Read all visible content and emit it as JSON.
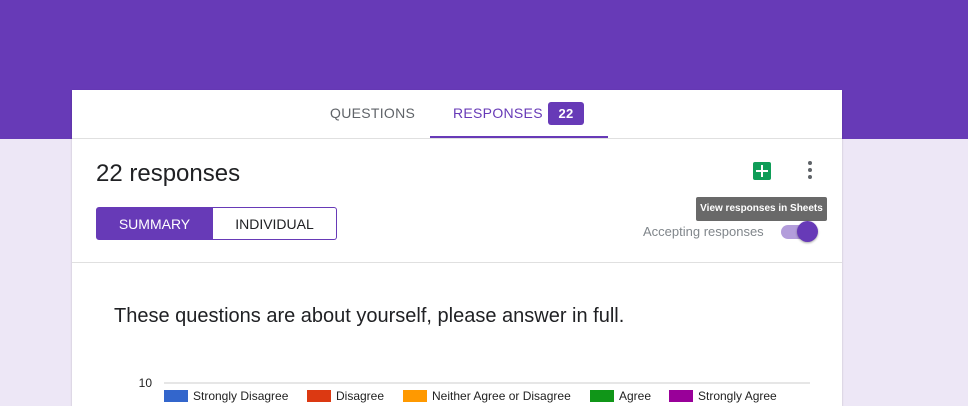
{
  "tabs": {
    "questions_label": "QUESTIONS",
    "responses_label": "RESPONSES",
    "responses_count": "22"
  },
  "summary_header": {
    "title": "22 responses",
    "tooltip": "View responses in Sheets",
    "accepting_label": "Accepting responses",
    "accepting_on": true
  },
  "view_toggle": {
    "summary_label": "SUMMARY",
    "individual_label": "INDIVIDUAL",
    "selected": "summary"
  },
  "question": {
    "text": "These questions are about yourself, please answer in full."
  },
  "chart_data": {
    "type": "bar",
    "y_tick_labels": [
      "10"
    ],
    "series": [
      {
        "name": "Strongly Disagree",
        "color": "#3366cc"
      },
      {
        "name": "Disagree",
        "color": "#dc3912"
      },
      {
        "name": "Neither Agree or Disagree",
        "color": "#ff9900"
      },
      {
        "name": "Agree",
        "color": "#109618"
      },
      {
        "name": "Strongly Agree",
        "color": "#990099"
      }
    ],
    "legend_position": "top",
    "grid": true
  },
  "colors": {
    "accent": "#673ab7",
    "background": "#ede7f6",
    "sheets_green": "#0f9d58"
  },
  "icons": {
    "sheets": "sheets-icon",
    "more": "more-vert-icon"
  }
}
